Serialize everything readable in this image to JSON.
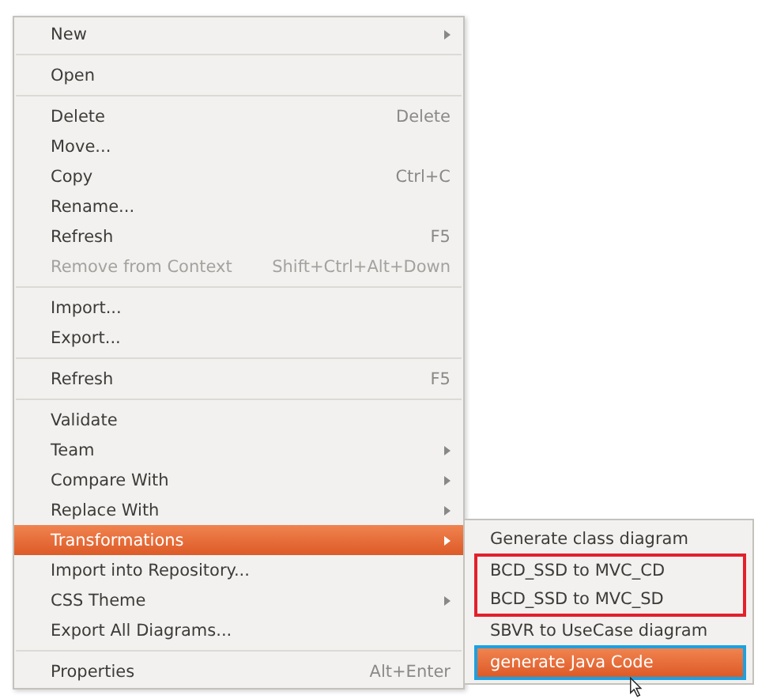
{
  "menu": {
    "groups": [
      [
        {
          "label": "New",
          "submenu": true,
          "disabled": false,
          "selected": false
        }
      ],
      [
        {
          "label": "Open",
          "submenu": false,
          "disabled": false,
          "selected": false
        }
      ],
      [
        {
          "label": "Delete",
          "shortcut": "Delete",
          "submenu": false,
          "disabled": false,
          "selected": false
        },
        {
          "label": "Move...",
          "submenu": false,
          "disabled": false,
          "selected": false
        },
        {
          "label": "Copy",
          "shortcut": "Ctrl+C",
          "submenu": false,
          "disabled": false,
          "selected": false
        },
        {
          "label": "Rename...",
          "submenu": false,
          "disabled": false,
          "selected": false
        },
        {
          "label": "Refresh",
          "shortcut": "F5",
          "submenu": false,
          "disabled": false,
          "selected": false
        },
        {
          "label": "Remove from Context",
          "shortcut": "Shift+Ctrl+Alt+Down",
          "submenu": false,
          "disabled": true,
          "selected": false
        }
      ],
      [
        {
          "label": "Import...",
          "submenu": false,
          "disabled": false,
          "selected": false
        },
        {
          "label": "Export...",
          "submenu": false,
          "disabled": false,
          "selected": false
        }
      ],
      [
        {
          "label": "Refresh",
          "shortcut": "F5",
          "submenu": false,
          "disabled": false,
          "selected": false
        }
      ],
      [
        {
          "label": "Validate",
          "submenu": false,
          "disabled": false,
          "selected": false
        },
        {
          "label": "Team",
          "submenu": true,
          "disabled": false,
          "selected": false
        },
        {
          "label": "Compare With",
          "submenu": true,
          "disabled": false,
          "selected": false
        },
        {
          "label": "Replace With",
          "submenu": true,
          "disabled": false,
          "selected": false
        },
        {
          "label": "Transformations",
          "submenu": true,
          "disabled": false,
          "selected": true
        },
        {
          "label": "Import into Repository...",
          "submenu": false,
          "disabled": false,
          "selected": false
        },
        {
          "label": "CSS Theme",
          "submenu": true,
          "disabled": false,
          "selected": false
        },
        {
          "label": "Export All Diagrams...",
          "submenu": false,
          "disabled": false,
          "selected": false
        }
      ],
      [
        {
          "label": "Properties",
          "shortcut": "Alt+Enter",
          "submenu": false,
          "disabled": false,
          "selected": false
        }
      ]
    ]
  },
  "submenu": {
    "groups": [
      {
        "items": [
          {
            "label": "Generate class diagram",
            "selected": false
          }
        ]
      },
      {
        "color": "#e3202c",
        "items": [
          {
            "label": "BCD_SSD to MVC_CD",
            "selected": false
          },
          {
            "label": "BCD_SSD to MVC_SD",
            "selected": false
          }
        ]
      },
      {
        "items": [
          {
            "label": "SBVR to UseCase diagram",
            "selected": false
          }
        ]
      },
      {
        "color": "#1ba1e2",
        "items": [
          {
            "label": "generate Java Code",
            "selected": true
          }
        ]
      }
    ]
  }
}
